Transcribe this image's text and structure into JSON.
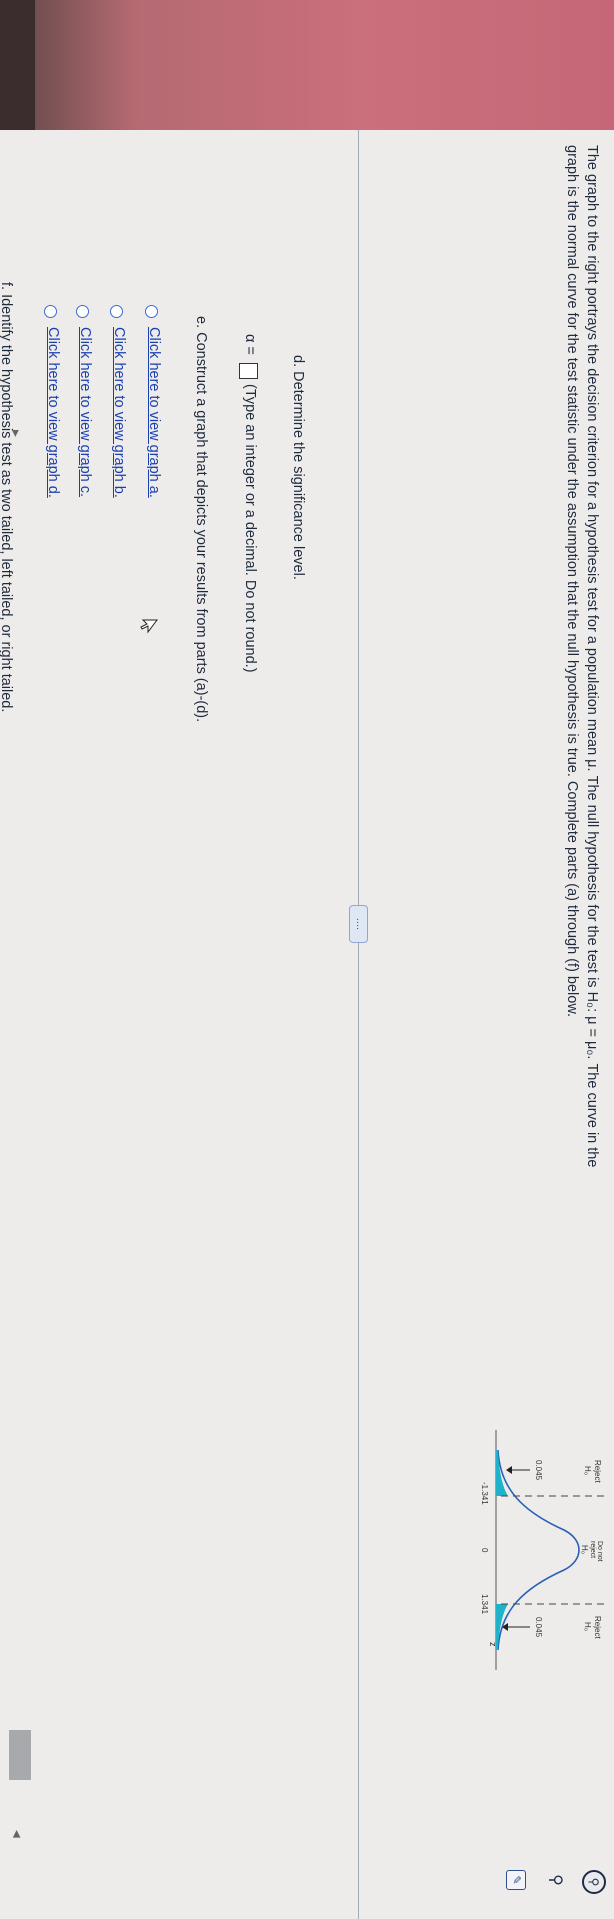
{
  "intro": {
    "line1": "The graph to the right portrays the decision criterion for a hypothesis test for a population mean μ. The null hypothesis for the test is H₀: μ = μ₀. The curve in the",
    "line2": "graph is the normal curve for the test statistic under the assumption that the null hypothesis is true. Complete parts (a) through (f) below."
  },
  "more_button": "....",
  "part_d": {
    "question": "d. Determine the significance level.",
    "alpha_label": "α =",
    "answer_value": "",
    "hint": "(Type an integer or a decimal. Do not round.)"
  },
  "part_e": {
    "question": "e. Construct a graph that depicts your results from parts (a)-(d).",
    "options": [
      "Click here to view graph a.",
      "Click here to view graph b.",
      "Click here to view graph c.",
      "Click here to view graph d."
    ]
  },
  "part_f": {
    "question": "f. Identify the hypothesis test as two tailed, left tailed, or right tailed."
  },
  "graph": {
    "reject_left": "Reject",
    "h0_left": "H₀",
    "do_not_reject_1": "Do not",
    "do_not_reject_2": "reject",
    "h0_middle": "H₀",
    "reject_right": "Reject",
    "h0_right": "H₀",
    "area_left": "0.045",
    "area_right": "0.045",
    "critical_left": "-1.341",
    "center": "0",
    "critical_right": "1.341",
    "axis_label": "z",
    "fill_color": "#1fb3c9"
  },
  "tools": {
    "search_icon": "search-icon",
    "zoom_icon": "zoom-icon",
    "edit_icon": "edit-icon"
  }
}
